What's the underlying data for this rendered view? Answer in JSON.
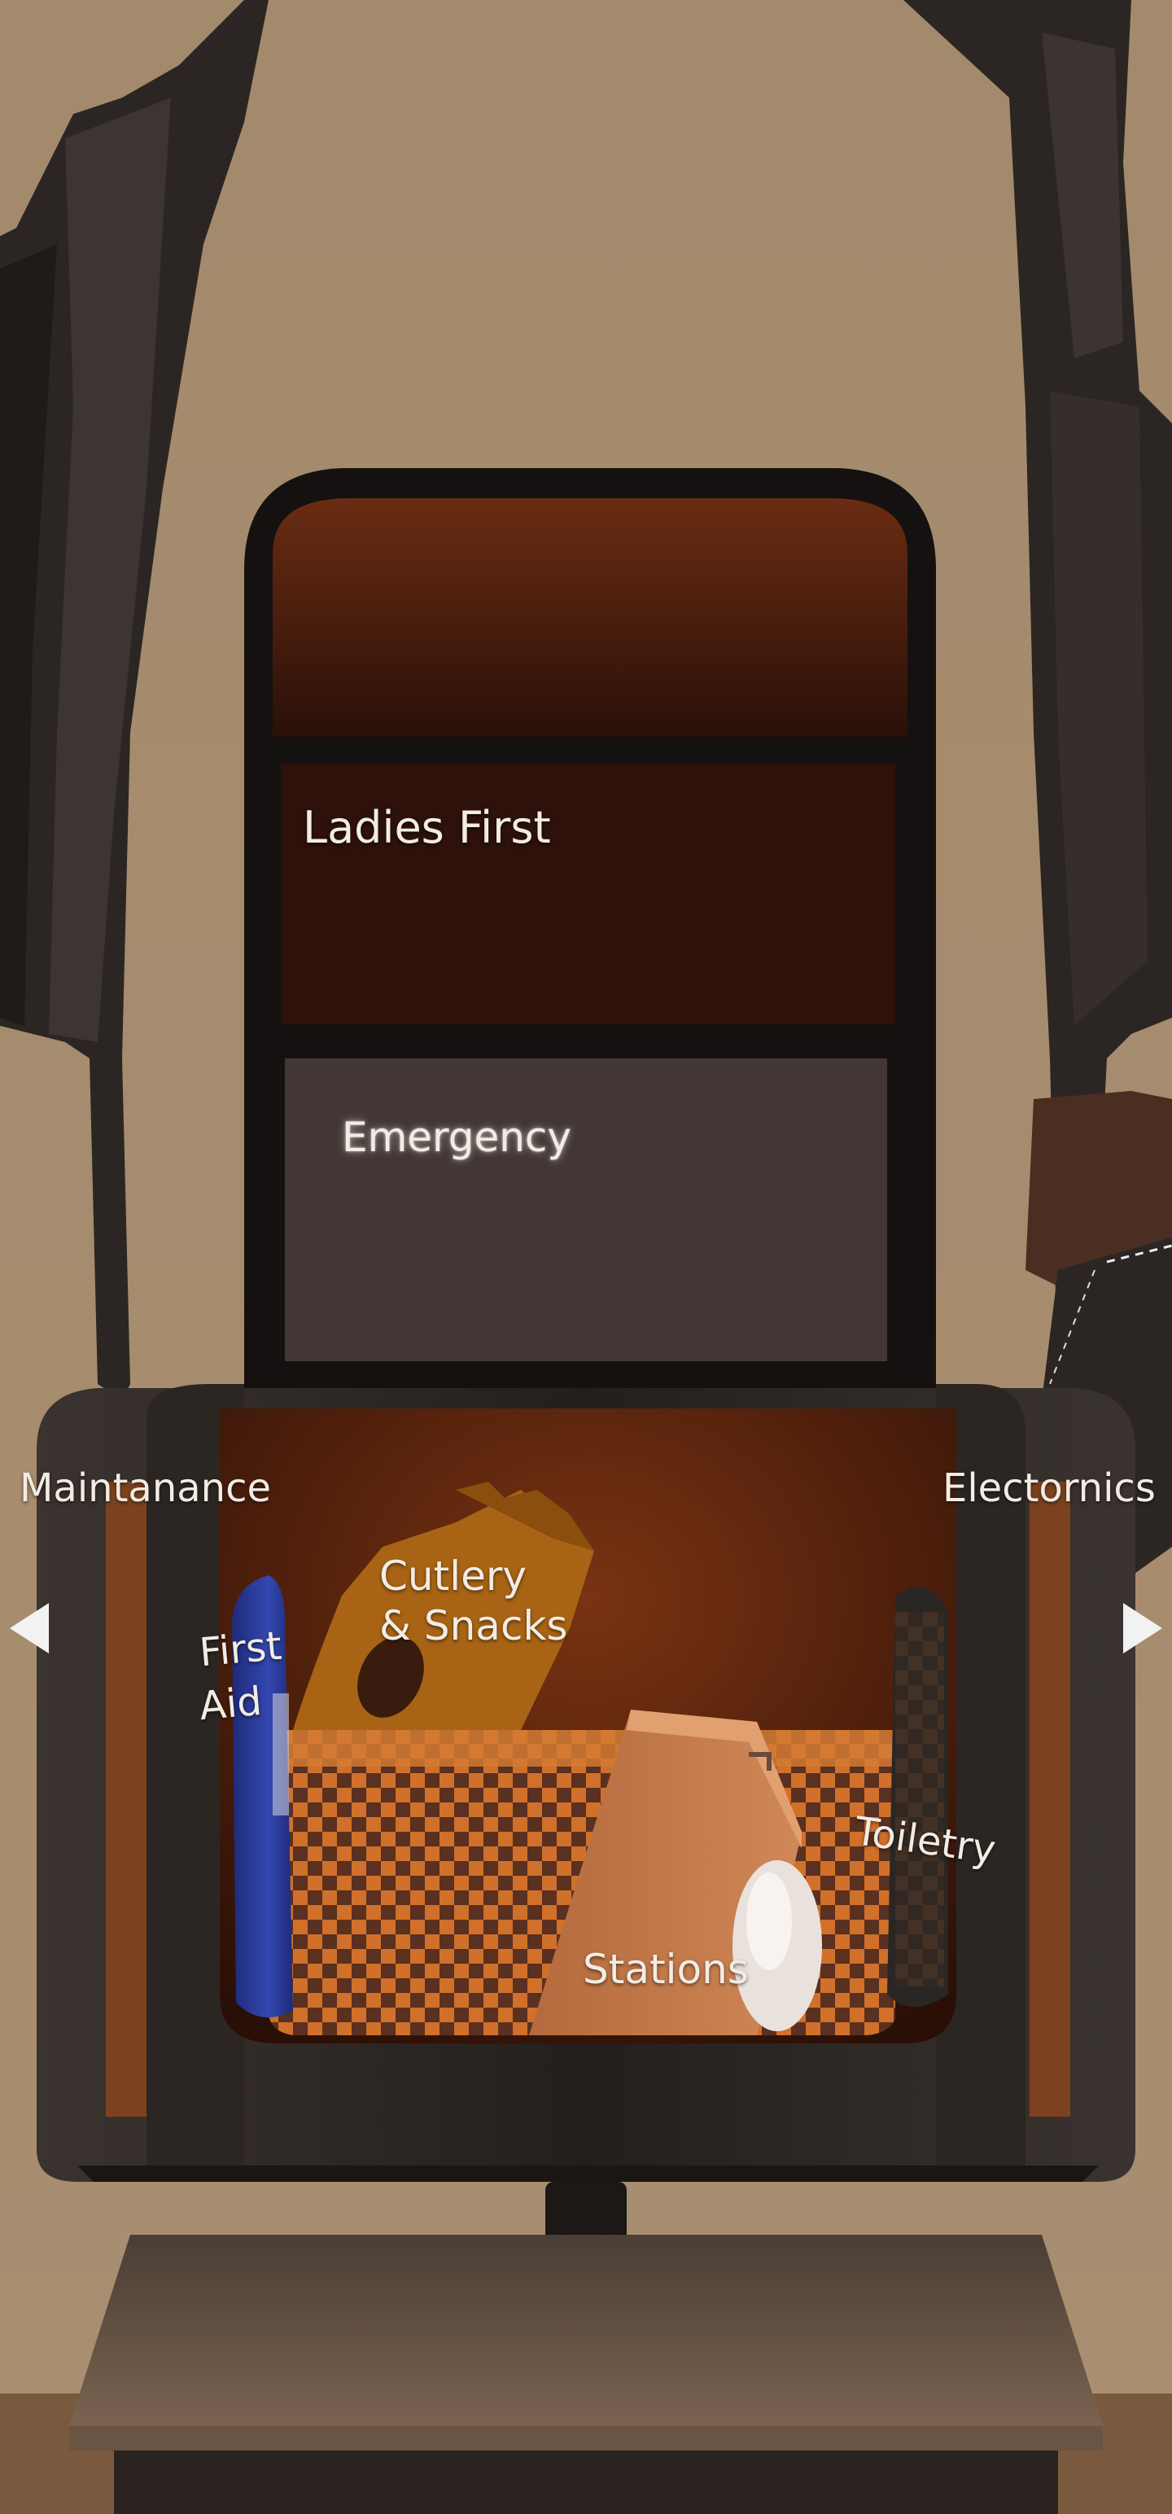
{
  "colors": {
    "wall": "#a88d6e",
    "case_dark": "#2a2522",
    "panel_lid": "#2a110a",
    "panel_emergency": "#433735",
    "interior_orange": "#c86a24",
    "checker_dark": "#4a2a1a",
    "label_text": "#f2ece4"
  },
  "compartments": {
    "ladies_first": "Ladies First",
    "emergency": "Emergency",
    "maintanance": "Maintanance",
    "electornics": "Electornics",
    "first_aid_line1": "First",
    "first_aid_line2": "Aid",
    "cutlery_line1": "Cutlery",
    "cutlery_line2": "& Snacks",
    "toiletry": "Toiletry",
    "stations": "Stations"
  },
  "navigation": {
    "prev_icon": "triangle-left-icon",
    "next_icon": "triangle-right-icon"
  }
}
